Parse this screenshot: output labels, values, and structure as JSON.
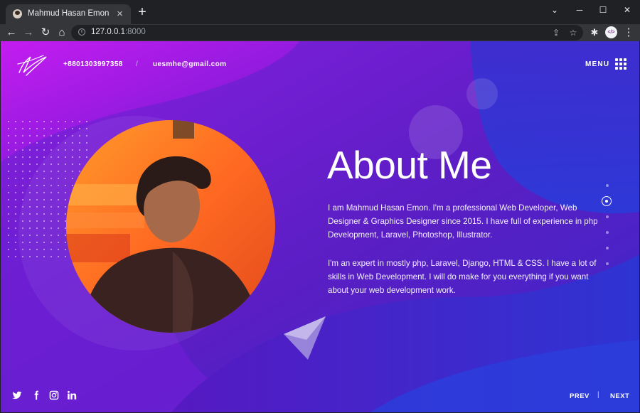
{
  "browser": {
    "tab_title": "Mahmud Hasan Emon",
    "url_host": "127.0.0.1",
    "url_port": ":8000",
    "profile_badge": "</>"
  },
  "header": {
    "phone": "+8801303997358",
    "separator": "/",
    "email": "uesmhe@gmail.com",
    "menu_label": "MENU"
  },
  "about": {
    "title": "About Me",
    "paragraphs": [
      "I am Mahmud Hasan Emon. I'm a professional Web Developer, Web Designer & Graphics Designer since 2015. I have full of experience in php Development, Laravel, Photoshop, Illustrator.",
      "I'm an expert in mostly php, Laravel, Django, HTML & CSS. I have a lot of skills in Web Development. I will do make for you everything if you want about your web development work."
    ]
  },
  "section_nav": {
    "count": 6,
    "active_index": 1
  },
  "social_icons": [
    "twitter-icon",
    "facebook-icon",
    "instagram-icon",
    "linkedin-icon"
  ],
  "footer_nav": {
    "prev": "PREV",
    "separator": "|",
    "next": "NEXT"
  },
  "colors": {
    "page_bg": "#5a1ec4",
    "accent_magenta": "#b316e8",
    "accent_blue": "#2b3bd6",
    "photo_orange": "#ff6a22"
  }
}
